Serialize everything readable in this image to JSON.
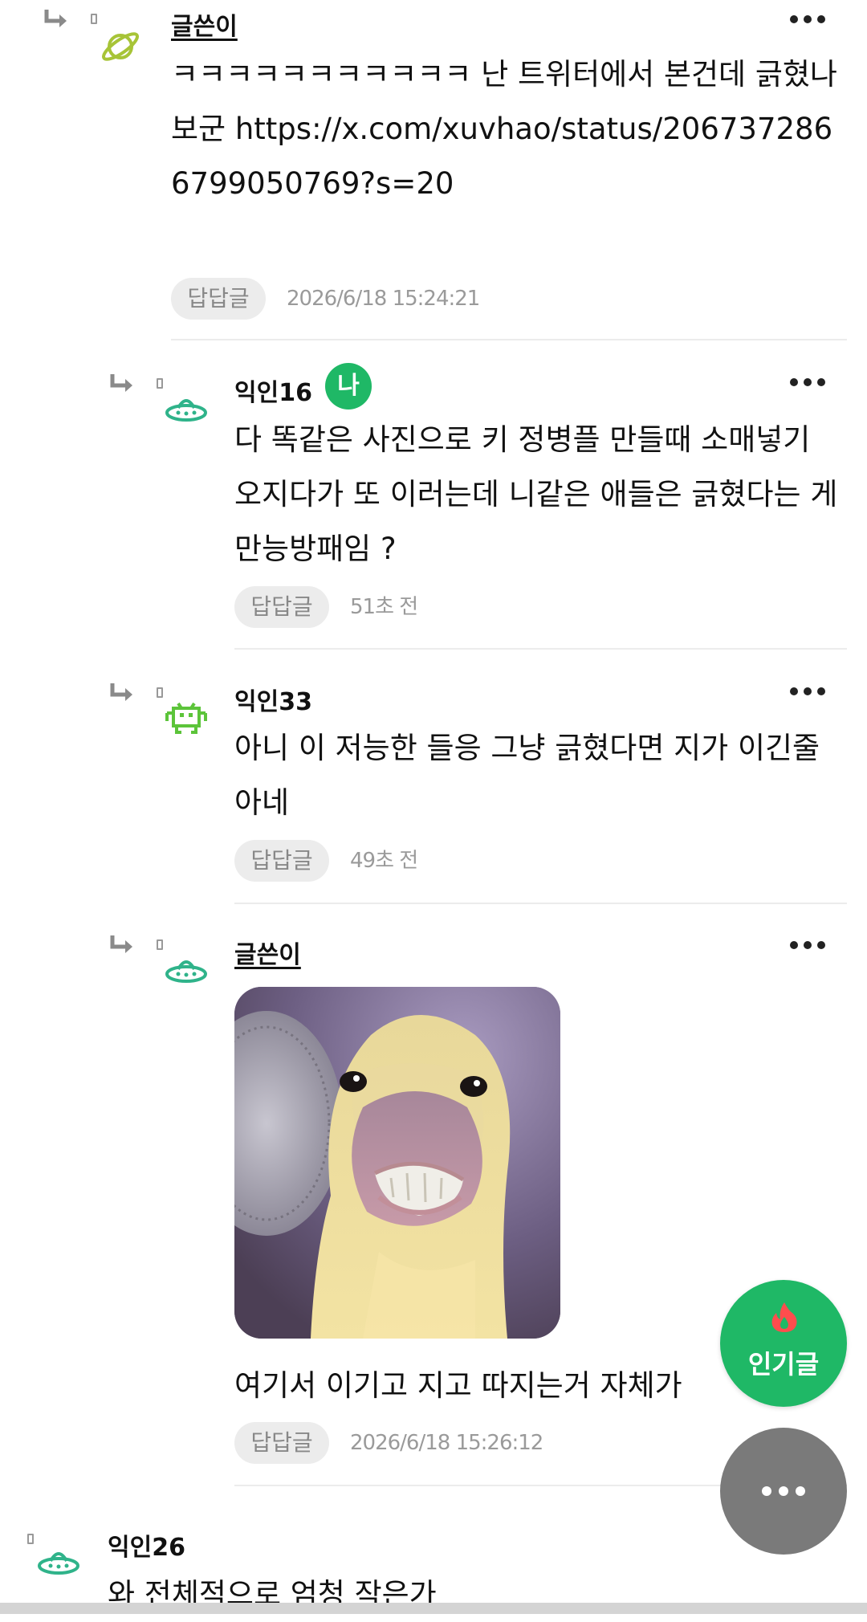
{
  "comments": [
    {
      "author": "글쓴이",
      "text": "ㅋㅋㅋㅋㅋㅋㅋㅋㅋㅋㅋ 난 트위터에서 본건데 긁혔나 보군 https://x.com/xuvhao/status/2067372866799050769?s=20",
      "reply_label": "답답글",
      "time": "2026/6/18 15:24:21",
      "avatar_icon": "planet-icon"
    },
    {
      "author": "익인16",
      "me_badge": "나",
      "text": "다 똑같은 사진으로 키 정병플 만들때 소매넣기 오지다가 또 이러는데 니같은 애들은 긁혔다는 게 만능방패임 ?",
      "reply_label": "답답글",
      "time": "51초 전",
      "avatar_icon": "ufo-icon"
    },
    {
      "author": "익인33",
      "text": "아니 이 저능한 들응 그냥 긁혔다면 지가 이긴줄 아네",
      "reply_label": "답답글",
      "time": "49초 전",
      "avatar_icon": "space-invader-icon"
    },
    {
      "author": "글쓴이",
      "text": "여기서 이기고 지고 따지는거 자체가",
      "reply_label": "답답글",
      "time": "2026/6/18 15:26:12",
      "avatar_icon": "ufo-icon"
    },
    {
      "author": "익인26",
      "text": "와 전체적으로 엄청 작은가",
      "avatar_icon": "ufo-icon"
    }
  ],
  "fab": {
    "popular_label": "인기글",
    "popular_icon": "flame-icon",
    "more_icon": "more-dots-icon"
  },
  "colors": {
    "accent_green": "#1fb866",
    "fab_gray": "#7a7a7a",
    "planet_green": "#a7c437",
    "ufo_green": "#2fb38a",
    "invader_green": "#5cc43a"
  }
}
